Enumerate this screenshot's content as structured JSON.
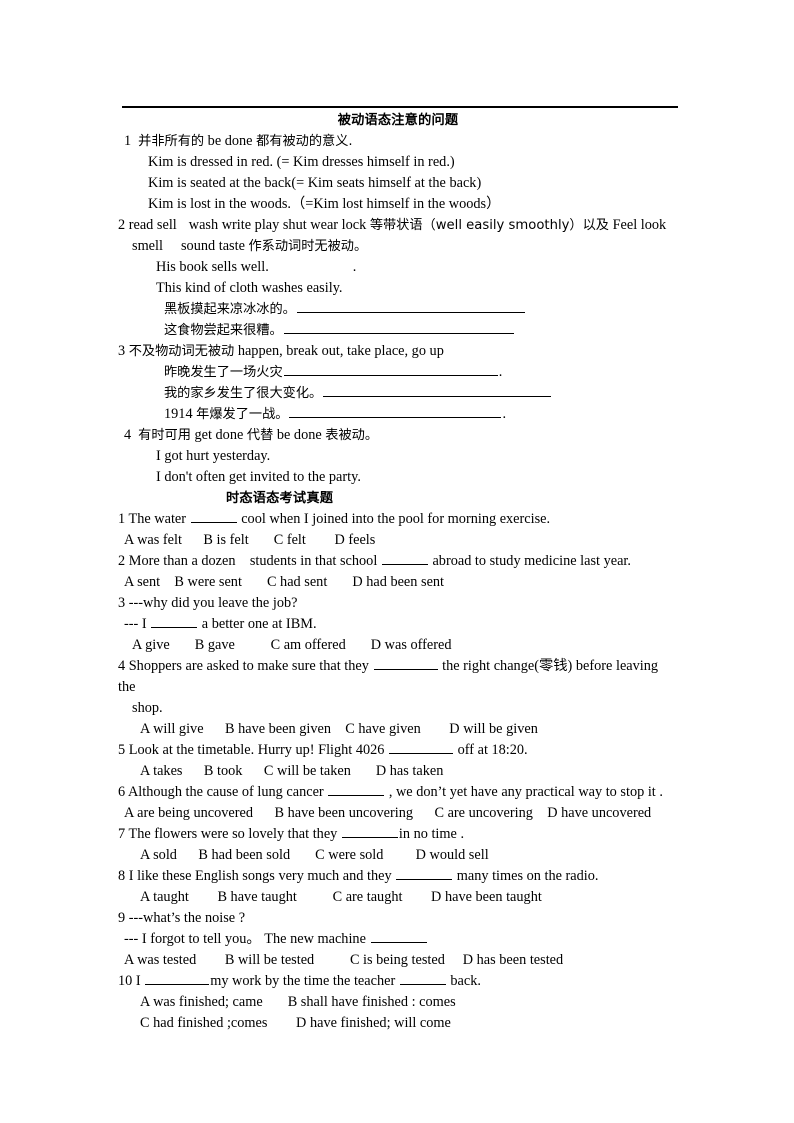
{
  "document": {
    "section1": {
      "title": "被动语态注意的问题",
      "items": [
        {
          "num": "1",
          "lead_cn_a": "并非所有的",
          "lead_en": "be done",
          "lead_cn_b": "都有被动的意义.",
          "examples": [
            "Kim is dressed in red. (= Kim dresses himself in red.)",
            "Kim is seated at the back(= Kim seats himself at the back)",
            "Kim is lost in the woods.（=Kim lost himself in the woods）"
          ]
        },
        {
          "num": "2",
          "line1_a": "read sell",
          "line1_b": "wash write play shut wear lock",
          "line1_c": "等带状语（well easily smoothly）以及",
          "line1_d": "Feel look",
          "line2_a": "smell",
          "line2_b": "sound taste",
          "line2_c": "作系动词时无被动。",
          "ex1": "His book sells well.",
          "ex1_dot": ".",
          "ex2": "This kind of cloth washes easily.",
          "ex3_cn": "黑板摸起来凉冰冰的。",
          "ex4_cn": "这食物尝起来很糟。"
        },
        {
          "num": "3",
          "lead_cn": "不及物动词无被动",
          "lead_en": "happen, break out, take place, go up",
          "ex1_cn": "昨晚发生了一场火灾",
          "ex1_tail": ".",
          "ex2_cn": "我的家乡发生了很大变化。",
          "ex3_cn_a": "1914",
          "ex3_cn_b": "年爆发了一战。",
          "ex3_tail": "."
        },
        {
          "num": "4",
          "lead_cn_a": "有时可用",
          "lead_en_a": "get done",
          "lead_cn_b": "代替",
          "lead_en_b": "be done",
          "lead_cn_c": "表被动。",
          "examples": [
            "I got hurt yesterday.",
            "I don't often get invited to the party."
          ]
        }
      ]
    },
    "section2": {
      "title": "时态语态考试真题",
      "questions": [
        {
          "num": "1",
          "stem_pre": "The water",
          "stem_post": "cool when I joined into the pool for morning exercise.",
          "options": "A was felt      B is felt       C felt        D feels"
        },
        {
          "num": "2",
          "stem_pre": "More than a dozen    students in that school",
          "stem_post": "abroad to study medicine last year.",
          "options": "A sent    B were sent       C had sent       D had been sent"
        },
        {
          "num": "3",
          "stem_line1": "---why did you leave the job?",
          "stem_line2_pre": "--- I",
          "stem_line2_post": "a better one at IBM.",
          "options": "A give       B gave          C am offered       D was offered"
        },
        {
          "num": "4",
          "stem_pre": "Shoppers are asked to make sure that they",
          "stem_post": "the right change(零钱) before leaving the",
          "stem_line2": "shop.",
          "options": "A will give      B have been given    C have given        D will be given"
        },
        {
          "num": "5",
          "stem_pre": "Look at the timetable. Hurry up! Flight 4026",
          "stem_post": "off at 18:20.",
          "options": "A takes      B took      C will be taken       D has taken"
        },
        {
          "num": "6",
          "stem_pre": "Although the cause of lung cancer",
          "stem_post": ", we don’t yet have any practical way to stop it .",
          "options": "A are being uncovered      B have been uncovering      C are uncovering    D have uncovered"
        },
        {
          "num": "7",
          "stem_pre": "The flowers were so lovely that they",
          "stem_post": "in no time .",
          "options": "A sold      B had been sold       C were sold         D would sell"
        },
        {
          "num": "8",
          "stem_pre": "I like these English songs very much and they",
          "stem_post": "many times on the radio.",
          "options": "A taught        B have taught          C are taught        D have been taught"
        },
        {
          "num": "9",
          "stem_line1": "---what’s the noise ?",
          "stem_line2_pre": "--- I forgot to tell you。 The new machine",
          "options": "A was tested        B will be tested          C is being tested     D has been tested"
        },
        {
          "num": "10",
          "stem_pre": "I",
          "stem_mid": "my work by the time the teacher",
          "stem_post": "back.",
          "options_line1": "A was finished; came       B shall have finished : comes",
          "options_line2": "C had finished ;comes        D have finished; will come"
        }
      ]
    }
  }
}
